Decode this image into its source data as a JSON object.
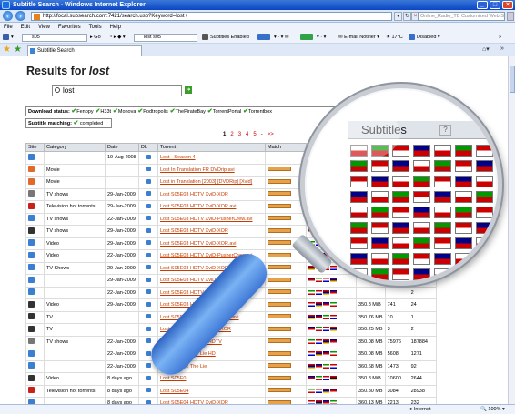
{
  "window": {
    "title": "Subtitle Search - Windows Internet Explorer"
  },
  "addressbar": {
    "url": "http://focal.subsearch.com:7421/search.usp?Keyword=lost+",
    "live_search_placeholder": "Online_Radio_TB Customized Web Sear"
  },
  "menu": [
    "File",
    "Edit",
    "View",
    "Favorites",
    "Tools",
    "Help"
  ],
  "toolbar": {
    "box1": "s05",
    "go_label": "Go",
    "box2": "lost s05",
    "subtitles_enabled": "Subtitles Enabled",
    "rss1": "RSS",
    "rss2": "RSS",
    "email": "E-mail Notifier",
    "weather": "17°C",
    "disabled": "Disabled"
  },
  "tab": {
    "label": "Subtitle Search"
  },
  "page": {
    "results_prefix": "Results for ",
    "query": "lost",
    "search_value": "lost",
    "download_status_label": "Download status:",
    "sources": [
      "Fenopy",
      "H33t",
      "Monova",
      "Podtropolis",
      "ThePirateBay",
      "TorrentPortal",
      "Torrentbox"
    ],
    "matching_label": "Subtitle matching:",
    "matching_value": "completed",
    "pages": [
      "1",
      "2",
      "3",
      "4",
      "5",
      "-",
      ">>"
    ]
  },
  "table": {
    "headers": [
      "Site",
      "Category",
      "Date",
      "DL",
      "Torrent",
      "Match"
    ],
    "rows": [
      {
        "cat": "",
        "date": "19-Aug-2008",
        "torrent": "Lost - Season 4",
        "size": "",
        "c1": "",
        "c2": ""
      },
      {
        "cat": "Movie",
        "date": "",
        "torrent": "Lost In Translation FR DVDrip.avi",
        "size": "",
        "c1": "",
        "c2": ""
      },
      {
        "cat": "Movie",
        "date": "",
        "torrent": "Lost in Translation [2003] [DVDRip] [Xvid]",
        "size": "",
        "c1": "",
        "c2": ""
      },
      {
        "cat": "TV shows",
        "date": "29-Jan-2009",
        "torrent": "Lost S05E03 HDTV XviD-XOR",
        "size": "",
        "c1": "",
        "c2": ""
      },
      {
        "cat": "Television hot torrents",
        "date": "29-Jan-2009",
        "torrent": "Lost S05E03 HDTV XviD-XOR.avi",
        "size": "",
        "c1": "",
        "c2": ""
      },
      {
        "cat": "TV shows",
        "date": "22-Jan-2009",
        "torrent": "Lost S05E03 HDTV XviD-PusherCrew.avi",
        "size": "",
        "c1": "",
        "c2": ""
      },
      {
        "cat": "TV shows",
        "date": "29-Jan-2009",
        "torrent": "Lost S05E03 HDTV XviD-XOR",
        "size": "",
        "c1": "",
        "c2": ""
      },
      {
        "cat": "Video",
        "date": "29-Jan-2009",
        "torrent": "Lost S05E03 HDTV XviD-XOR.avi",
        "size": "",
        "c1": "",
        "c2": ""
      },
      {
        "cat": "Video",
        "date": "22-Jan-2009",
        "torrent": "Lost S05E03 HDTV XviD-PusherCrew.avi",
        "size": "",
        "c1": "",
        "c2": ""
      },
      {
        "cat": "TV Shows",
        "date": "29-Jan-2009",
        "torrent": "Lost S05E03 HDTV XviD-XOR",
        "size": "",
        "c1": "",
        "c2": "151"
      },
      {
        "cat": "",
        "date": "29-Jan-2009",
        "torrent": "Lost S05E03 HDTV XviD-XOR",
        "size": "",
        "c1": "1144",
        "c2": "4"
      },
      {
        "cat": "",
        "date": "22-Jan-2009",
        "torrent": "Lost S05E03 HDTV XviD-PusherCrew",
        "size": "",
        "c1": "",
        "c2": "2"
      },
      {
        "cat": "Video",
        "date": "29-Jan-2009",
        "torrent": "Lost S05E03 HDTV XviD-XOR.avi",
        "size": "350.8 MiB",
        "c1": "741",
        "c2": "24"
      },
      {
        "cat": "TV",
        "date": "",
        "torrent": "Lost S05E03 HDTV XviD - XOR.avi",
        "size": "350.76 MB",
        "c1": "10",
        "c2": "1"
      },
      {
        "cat": "TV",
        "date": "",
        "torrent": "Lost S05E03 HDTV XviD - XOR",
        "size": "350.25 MB",
        "c1": "3",
        "c2": "2"
      },
      {
        "cat": "TV shows",
        "date": "22-Jan-2009",
        "torrent": "Lost S05E02 The Lie HDTV",
        "size": "350.08 MB",
        "c1": "75976",
        "c2": "187884"
      },
      {
        "cat": "",
        "date": "22-Jan-2009",
        "torrent": "Lost S05E02 The Lie HD",
        "size": "350.08 MB",
        "c1": "5608",
        "c2": "1271"
      },
      {
        "cat": "",
        "date": "22-Jan-2009",
        "torrent": "Lost S05E02 The Lie",
        "size": "360.68 MB",
        "c1": "1473",
        "c2": "92"
      },
      {
        "cat": "Video",
        "date": "8 days ago",
        "torrent": "Lost S05E0",
        "size": "350.8 MiB",
        "c1": "10600",
        "c2": "2644"
      },
      {
        "cat": "Television hot torrents",
        "date": "8 days ago",
        "torrent": "Lost S05E04",
        "size": "350.80 MB",
        "c1": "3084",
        "c2": "28938"
      },
      {
        "cat": "",
        "date": "8 days ago",
        "torrent": "Lost S05E04 HDTV XviD-XOR",
        "size": "360.13 MB",
        "c1": "2213",
        "c2": "232"
      }
    ]
  },
  "lens": {
    "subtitles_label": "Subtitles",
    "help": "?"
  },
  "statusbar": {
    "zone": "Internet",
    "zoom": "100%"
  }
}
